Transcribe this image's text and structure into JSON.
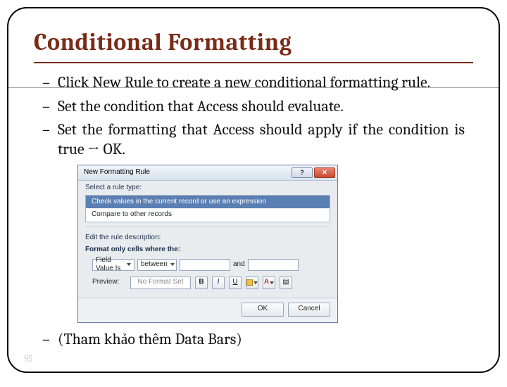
{
  "title": "Conditional Formatting",
  "bullets": {
    "b1": "Click New Rule to create a new conditional formatting rule.",
    "b2": "Set the condition that Access should evaluate.",
    "b3": "Set the formatting that Access should apply if the condition is true → OK.",
    "b4": "(Tham khảo  thêm Data Bars)"
  },
  "dialog": {
    "title": "New Formatting Rule",
    "section_select": "Select a rule type:",
    "ruletype_selected": "Check values in the current record or use an expression",
    "ruletype_other": "Compare to other records",
    "section_edit": "Edit the rule description:",
    "format_label": "Format only cells where the:",
    "field_combo": "Field Value Is",
    "op_combo": "between",
    "and_label": "and",
    "preview_label": "Preview:",
    "preview_text": "No Format Set",
    "bold": "B",
    "italic": "I",
    "underline": "U",
    "fontcolor": "A",
    "ok": "OK",
    "cancel": "Cancel",
    "close_glyph": "✕"
  },
  "page": "95"
}
